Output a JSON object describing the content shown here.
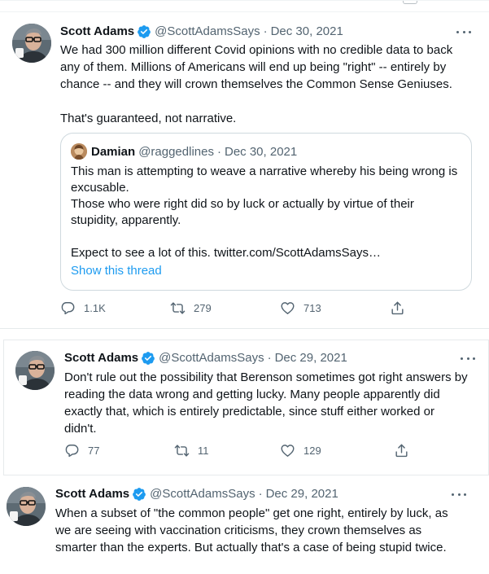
{
  "tweets": [
    {
      "author": "Scott Adams",
      "handle": "@ScottAdamsSays",
      "separator": "·",
      "date": "Dec 30, 2021",
      "text": [
        "We had 300 million different Covid opinions with no credible data to back",
        "any of them. Millions of Americans will end up being \"right\" -- entirely by",
        "chance -- and they will crown themselves the Common Sense Geniuses.",
        "",
        "That's guaranteed, not narrative."
      ],
      "quote": {
        "author": "Damian",
        "handle": "@raggedlines",
        "date": "Dec 30, 2021",
        "text": [
          "This man is attempting to weave a narrative whereby his being wrong is",
          "excusable.",
          "Those who were right did so by luck or actually by virtue of their",
          "stupidity, apparently.",
          "",
          "Expect to see a lot of this. twitter.com/ScottAdamsSays…"
        ],
        "show_thread": "Show this thread"
      },
      "replies": "1.1K",
      "retweets": "279",
      "likes": "713"
    },
    {
      "author": "Scott Adams",
      "handle": "@ScottAdamsSays",
      "separator": "·",
      "date": "Dec 29, 2021",
      "text": [
        "Don't rule out the possibility that Berenson sometimes got right answers by",
        "reading the data wrong and getting lucky. Many people apparently did",
        "exactly that, which is entirely predictable, since stuff either worked or",
        "didn't."
      ],
      "replies": "77",
      "retweets": "11",
      "likes": "129"
    },
    {
      "author": "Scott Adams",
      "handle": "@ScottAdamsSays",
      "separator": "·",
      "date": "Dec 29, 2021",
      "text": [
        "When a subset of \"the common people\" get one right, entirely by luck, as",
        "we are seeing with vaccination criticisms, they crown themselves as",
        "smarter than the experts. But actually that's a case of being stupid twice."
      ]
    }
  ],
  "colors": {
    "text": "#0f1419",
    "muted": "#536471",
    "link": "#1d9bf0",
    "verified": "#1d9bf0",
    "border": "#cfd9de"
  }
}
